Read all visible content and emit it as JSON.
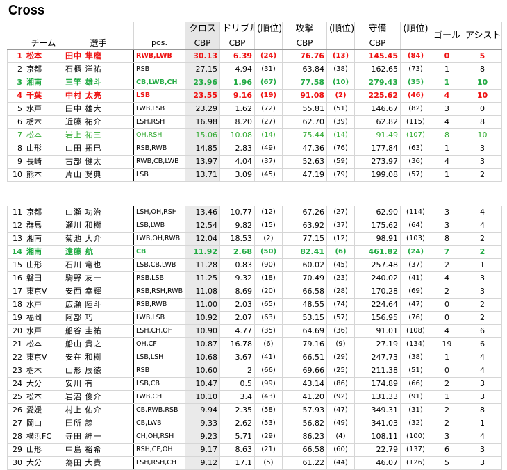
{
  "title": "Cross",
  "headers": {
    "team": "チーム",
    "player": "選手",
    "pos": "pos.",
    "cross": "クロス",
    "dribble": "ドリブル",
    "rank": "(順位)",
    "attack": "攻撃",
    "defense": "守備",
    "goal": "ゴール",
    "assist": "アシスト",
    "cbp": "CBP"
  },
  "rows_top": [
    {
      "rank": "1",
      "team": "松本",
      "player": "田中 隼磨",
      "pos": "RWB,LWB",
      "cross": "30.13",
      "dribble": "6.39",
      "dr": "(24)",
      "attack": "76.76",
      "ar": "(13)",
      "defense": "145.45",
      "der": "(84)",
      "goal": "0",
      "assist": "5",
      "style": "red first"
    },
    {
      "rank": "2",
      "team": "京都",
      "player": "石櫃 洋祐",
      "pos": "RSB",
      "cross": "27.15",
      "dribble": "4.94",
      "dr": "(31)",
      "attack": "63.84",
      "ar": "(38)",
      "defense": "162.65",
      "der": "(73)",
      "goal": "1",
      "assist": "8",
      "style": ""
    },
    {
      "rank": "3",
      "team": "湘南",
      "player": "三竿 雄斗",
      "pos": "CB,LWB,CH",
      "cross": "23.96",
      "dribble": "1.96",
      "dr": "(67)",
      "attack": "77.58",
      "ar": "(10)",
      "defense": "279.43",
      "der": "(35)",
      "goal": "1",
      "assist": "10",
      "style": "green"
    },
    {
      "rank": "4",
      "team": "千葉",
      "player": "中村 太亮",
      "pos": "LSB",
      "cross": "23.55",
      "dribble": "9.16",
      "dr": "(19)",
      "attack": "91.08",
      "ar": "(2)",
      "defense": "225.62",
      "der": "(46)",
      "goal": "4",
      "assist": "10",
      "style": "red"
    },
    {
      "rank": "5",
      "team": "水戸",
      "player": "田中 雄大",
      "pos": "LWB,LSB",
      "cross": "23.29",
      "dribble": "1.62",
      "dr": "(72)",
      "attack": "55.81",
      "ar": "(51)",
      "defense": "146.67",
      "der": "(82)",
      "goal": "3",
      "assist": "0",
      "style": ""
    },
    {
      "rank": "6",
      "team": "栃木",
      "player": "近藤 祐介",
      "pos": "LSH,RSH",
      "cross": "16.98",
      "dribble": "8.20",
      "dr": "(27)",
      "attack": "62.70",
      "ar": "(39)",
      "defense": "62.82",
      "der": "(115)",
      "goal": "4",
      "assist": "8",
      "style": ""
    },
    {
      "rank": "7",
      "team": "松本",
      "player": "岩上 祐三",
      "pos": "OH,RSH",
      "cross": "15.06",
      "dribble": "10.08",
      "dr": "(14)",
      "attack": "75.44",
      "ar": "(14)",
      "defense": "91.49",
      "der": "(107)",
      "goal": "8",
      "assist": "10",
      "style": "lgreen"
    },
    {
      "rank": "8",
      "team": "山形",
      "player": "山田 拓巳",
      "pos": "RSB,RWB",
      "cross": "14.85",
      "dribble": "2.83",
      "dr": "(49)",
      "attack": "47.36",
      "ar": "(76)",
      "defense": "177.84",
      "der": "(63)",
      "goal": "1",
      "assist": "3",
      "style": ""
    },
    {
      "rank": "9",
      "team": "長崎",
      "player": "古部 健太",
      "pos": "RWB,CB,LWB",
      "cross": "13.97",
      "dribble": "4.04",
      "dr": "(37)",
      "attack": "52.63",
      "ar": "(59)",
      "defense": "273.97",
      "der": "(36)",
      "goal": "4",
      "assist": "3",
      "style": ""
    },
    {
      "rank": "10",
      "team": "熊本",
      "player": "片山 奨典",
      "pos": "LSB",
      "cross": "13.71",
      "dribble": "3.09",
      "dr": "(45)",
      "attack": "47.19",
      "ar": "(79)",
      "defense": "199.08",
      "der": "(57)",
      "goal": "1",
      "assist": "2",
      "style": ""
    }
  ],
  "rows_bottom": [
    {
      "rank": "11",
      "team": "京都",
      "player": "山瀬 功治",
      "pos": "LSH,OH,RSH",
      "cross": "13.46",
      "dribble": "10.77",
      "dr": "(12)",
      "attack": "67.26",
      "ar": "(27)",
      "defense": "62.90",
      "der": "(114)",
      "goal": "3",
      "assist": "4",
      "style": ""
    },
    {
      "rank": "12",
      "team": "群馬",
      "player": "瀬川 和樹",
      "pos": "LSB,LWB",
      "cross": "12.54",
      "dribble": "9.82",
      "dr": "(15)",
      "attack": "63.92",
      "ar": "(37)",
      "defense": "175.62",
      "der": "(64)",
      "goal": "3",
      "assist": "4",
      "style": ""
    },
    {
      "rank": "13",
      "team": "湘南",
      "player": "菊池 大介",
      "pos": "LWB,OH,RWB",
      "cross": "12.04",
      "dribble": "18.53",
      "dr": "(2)",
      "attack": "77.15",
      "ar": "(12)",
      "defense": "98.91",
      "der": "(103)",
      "goal": "8",
      "assist": "2",
      "style": ""
    },
    {
      "rank": "14",
      "team": "湘南",
      "player": "遠藤 航",
      "pos": "CB",
      "cross": "11.92",
      "dribble": "2.68",
      "dr": "(50)",
      "attack": "82.41",
      "ar": "(6)",
      "defense": "461.82",
      "der": "(24)",
      "goal": "7",
      "assist": "2",
      "style": "green"
    },
    {
      "rank": "15",
      "team": "山形",
      "player": "石川 竜也",
      "pos": "LSB,CB,LWB",
      "cross": "11.28",
      "dribble": "0.83",
      "dr": "(90)",
      "attack": "60.02",
      "ar": "(45)",
      "defense": "257.48",
      "der": "(37)",
      "goal": "2",
      "assist": "1",
      "style": ""
    },
    {
      "rank": "16",
      "team": "磐田",
      "player": "駒野 友一",
      "pos": "RSB,LSB",
      "cross": "11.25",
      "dribble": "9.32",
      "dr": "(18)",
      "attack": "70.49",
      "ar": "(23)",
      "defense": "240.02",
      "der": "(41)",
      "goal": "4",
      "assist": "3",
      "style": ""
    },
    {
      "rank": "17",
      "team": "東京V",
      "player": "安西 幸輝",
      "pos": "RSB,RSH,RWB",
      "cross": "11.08",
      "dribble": "8.69",
      "dr": "(20)",
      "attack": "66.58",
      "ar": "(28)",
      "defense": "170.28",
      "der": "(69)",
      "goal": "2",
      "assist": "3",
      "style": ""
    },
    {
      "rank": "18",
      "team": "水戸",
      "player": "広瀬 陸斗",
      "pos": "RSB,RWB",
      "cross": "11.00",
      "dribble": "2.03",
      "dr": "(65)",
      "attack": "48.55",
      "ar": "(74)",
      "defense": "224.64",
      "der": "(47)",
      "goal": "0",
      "assist": "2",
      "style": ""
    },
    {
      "rank": "19",
      "team": "福岡",
      "player": "阿部 巧",
      "pos": "LWB,LSB",
      "cross": "10.92",
      "dribble": "2.07",
      "dr": "(63)",
      "attack": "53.15",
      "ar": "(57)",
      "defense": "156.95",
      "der": "(76)",
      "goal": "0",
      "assist": "2",
      "style": ""
    },
    {
      "rank": "20",
      "team": "水戸",
      "player": "船谷 圭祐",
      "pos": "LSH,CH,OH",
      "cross": "10.90",
      "dribble": "4.77",
      "dr": "(35)",
      "attack": "64.69",
      "ar": "(36)",
      "defense": "91.01",
      "der": "(108)",
      "goal": "4",
      "assist": "6",
      "style": ""
    },
    {
      "rank": "21",
      "team": "松本",
      "player": "船山 貴之",
      "pos": "OH,CF",
      "cross": "10.87",
      "dribble": "16.78",
      "dr": "(6)",
      "attack": "79.16",
      "ar": "(9)",
      "defense": "27.19",
      "der": "(134)",
      "goal": "19",
      "assist": "6",
      "style": ""
    },
    {
      "rank": "22",
      "team": "東京V",
      "player": "安在 和樹",
      "pos": "LSB,LSH",
      "cross": "10.68",
      "dribble": "3.67",
      "dr": "(41)",
      "attack": "66.51",
      "ar": "(29)",
      "defense": "247.73",
      "der": "(38)",
      "goal": "1",
      "assist": "4",
      "style": ""
    },
    {
      "rank": "23",
      "team": "栃木",
      "player": "山形 辰徳",
      "pos": "RSB",
      "cross": "10.60",
      "dribble": "2",
      "dr": "(66)",
      "attack": "69.66",
      "ar": "(25)",
      "defense": "211.38",
      "der": "(51)",
      "goal": "0",
      "assist": "4",
      "style": ""
    },
    {
      "rank": "24",
      "team": "大分",
      "player": "安川 有",
      "pos": "LSB,CB",
      "cross": "10.47",
      "dribble": "0.5",
      "dr": "(99)",
      "attack": "43.14",
      "ar": "(86)",
      "defense": "174.89",
      "der": "(66)",
      "goal": "2",
      "assist": "3",
      "style": ""
    },
    {
      "rank": "25",
      "team": "松本",
      "player": "岩沼 俊介",
      "pos": "LWB,CH",
      "cross": "10.10",
      "dribble": "3.4",
      "dr": "(43)",
      "attack": "41.20",
      "ar": "(92)",
      "defense": "131.33",
      "der": "(91)",
      "goal": "1",
      "assist": "3",
      "style": ""
    },
    {
      "rank": "26",
      "team": "愛媛",
      "player": "村上 佑介",
      "pos": "CB,RWB,RSB",
      "cross": "9.94",
      "dribble": "2.35",
      "dr": "(58)",
      "attack": "57.93",
      "ar": "(47)",
      "defense": "349.31",
      "der": "(31)",
      "goal": "2",
      "assist": "8",
      "style": ""
    },
    {
      "rank": "27",
      "team": "岡山",
      "player": "田所 諒",
      "pos": "CB,LWB",
      "cross": "9.33",
      "dribble": "2.62",
      "dr": "(53)",
      "attack": "56.82",
      "ar": "(49)",
      "defense": "341.03",
      "der": "(32)",
      "goal": "2",
      "assist": "1",
      "style": ""
    },
    {
      "rank": "28",
      "team": "横浜FC",
      "player": "寺田 紳一",
      "pos": "CH,OH,RSH",
      "cross": "9.23",
      "dribble": "5.71",
      "dr": "(29)",
      "attack": "86.23",
      "ar": "(4)",
      "defense": "108.11",
      "der": "(100)",
      "goal": "3",
      "assist": "4",
      "style": ""
    },
    {
      "rank": "29",
      "team": "山形",
      "player": "中島 裕希",
      "pos": "RSH,CF,OH",
      "cross": "9.17",
      "dribble": "8.63",
      "dr": "(21)",
      "attack": "66.58",
      "ar": "(60)",
      "defense": "22.79",
      "der": "(137)",
      "goal": "6",
      "assist": "3",
      "style": ""
    },
    {
      "rank": "30",
      "team": "大分",
      "player": "為田 大貴",
      "pos": "LSH,RSH,CH",
      "cross": "9.12",
      "dribble": "17.1",
      "dr": "(5)",
      "attack": "61.22",
      "ar": "(44)",
      "defense": "46.07",
      "der": "(126)",
      "goal": "5",
      "assist": "3",
      "style": ""
    }
  ]
}
